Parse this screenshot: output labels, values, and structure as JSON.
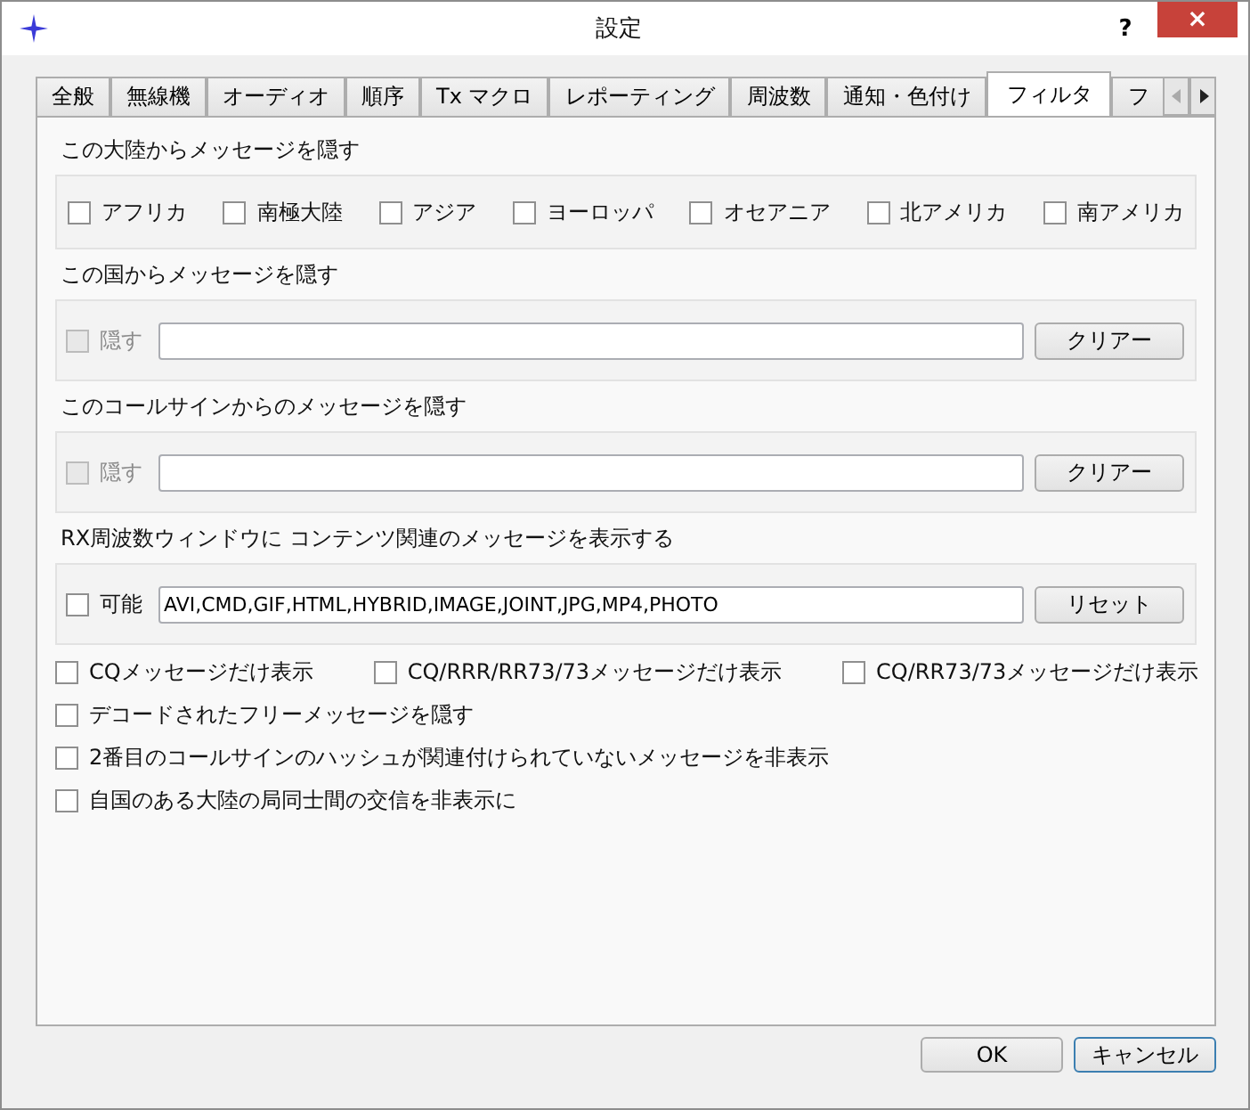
{
  "window": {
    "title": "設定",
    "help": "?",
    "close": "×"
  },
  "tabs": [
    {
      "label": "全般",
      "selected": false
    },
    {
      "label": "無線機",
      "selected": false
    },
    {
      "label": "オーディオ",
      "selected": false
    },
    {
      "label": "順序",
      "selected": false
    },
    {
      "label": "Tx マクロ",
      "selected": false
    },
    {
      "label": "レポーティング",
      "selected": false
    },
    {
      "label": "周波数",
      "selected": false
    },
    {
      "label": "通知・色付け",
      "selected": false
    },
    {
      "label": "フィルタ",
      "selected": true
    },
    {
      "label": "フ",
      "selected": false
    }
  ],
  "continents": {
    "title": "この大陸からメッセージを隠す",
    "items": [
      {
        "label": "アフリカ",
        "checked": false
      },
      {
        "label": "南極大陸",
        "checked": false
      },
      {
        "label": "アジア",
        "checked": false
      },
      {
        "label": "ヨーロッパ",
        "checked": false
      },
      {
        "label": "オセアニア",
        "checked": false
      },
      {
        "label": "北アメリカ",
        "checked": false
      },
      {
        "label": "南アメリカ",
        "checked": false
      }
    ]
  },
  "field_groups": [
    {
      "title": "この国からメッセージを隠す",
      "toggle": {
        "label": "隠す",
        "checked": false,
        "disabled": true
      },
      "button": "クリアー"
    },
    {
      "title": "このコールサインからのメッセージを隠す",
      "toggle": {
        "label": "隠す",
        "checked": false,
        "disabled": true
      },
      "button": "クリアー"
    },
    {
      "title": "RX周波数ウィンドウに コンテンツ関連のメッセージを表示する",
      "toggle": {
        "label": "可能",
        "checked": false,
        "disabled": false
      },
      "value": "AVI,CMD,GIF,HTML,HYBRID,IMAGE,JOINT,JPG,MP4,PHOTO",
      "button": "リセット"
    }
  ],
  "option_rows": [
    [
      {
        "label": "CQメッセージだけ表示",
        "checked": false
      },
      {
        "label": "CQ/RRR/RR73/73メッセージだけ表示",
        "checked": false
      },
      {
        "label": "CQ/RR73/73メッセージだけ表示",
        "checked": false
      }
    ],
    [
      {
        "label": "デコードされたフリーメッセージを隠す",
        "checked": false
      }
    ],
    [
      {
        "label": "2番目のコールサインのハッシュが関連付けられていないメッセージを非表示",
        "checked": false
      }
    ],
    [
      {
        "label": "自国のある大陸の局同士間の交信を非表示に",
        "checked": false
      }
    ]
  ],
  "buttons": [
    {
      "label": "OK",
      "focused": false
    },
    {
      "label": "キャンセル",
      "focused": true
    }
  ]
}
